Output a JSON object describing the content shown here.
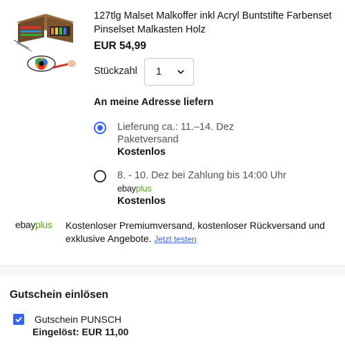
{
  "product": {
    "title": "127tlg Malset Malkoffer inkl Acryl Buntstifte Farbenset Pinselset Malkasten Holz",
    "price": "EUR 54,99"
  },
  "quantity": {
    "label": "Stückzahl",
    "value": "1"
  },
  "delivery": {
    "heading": "An meine Adresse liefern",
    "options": [
      {
        "line1": "Lieferung ca.: 11.–14. Dez",
        "line2": "Paketversand",
        "cost": "Kostenlos",
        "selected": true
      },
      {
        "line1": "8. - 10. Dez bei Zahlung bis 14:00 Uhr",
        "badge_ebay": "ebay",
        "badge_plus": "plus",
        "cost": "Kostenlos",
        "selected": false
      }
    ]
  },
  "ebayplus_promo": {
    "logo_ebay": "ebay",
    "logo_plus": "plus",
    "text": "Kostenloser Premiumversand, kostenloser Rückversand und exklusive Angebote.",
    "link": "Jetzt testen"
  },
  "voucher": {
    "heading": "Gutschein einlösen",
    "name": "Gutschein PUNSCH",
    "redeemed": "Eingelöst: EUR 11,00",
    "checked": true
  },
  "colors": {
    "accent": "#3665f3",
    "plus_green": "#5ba71b"
  }
}
